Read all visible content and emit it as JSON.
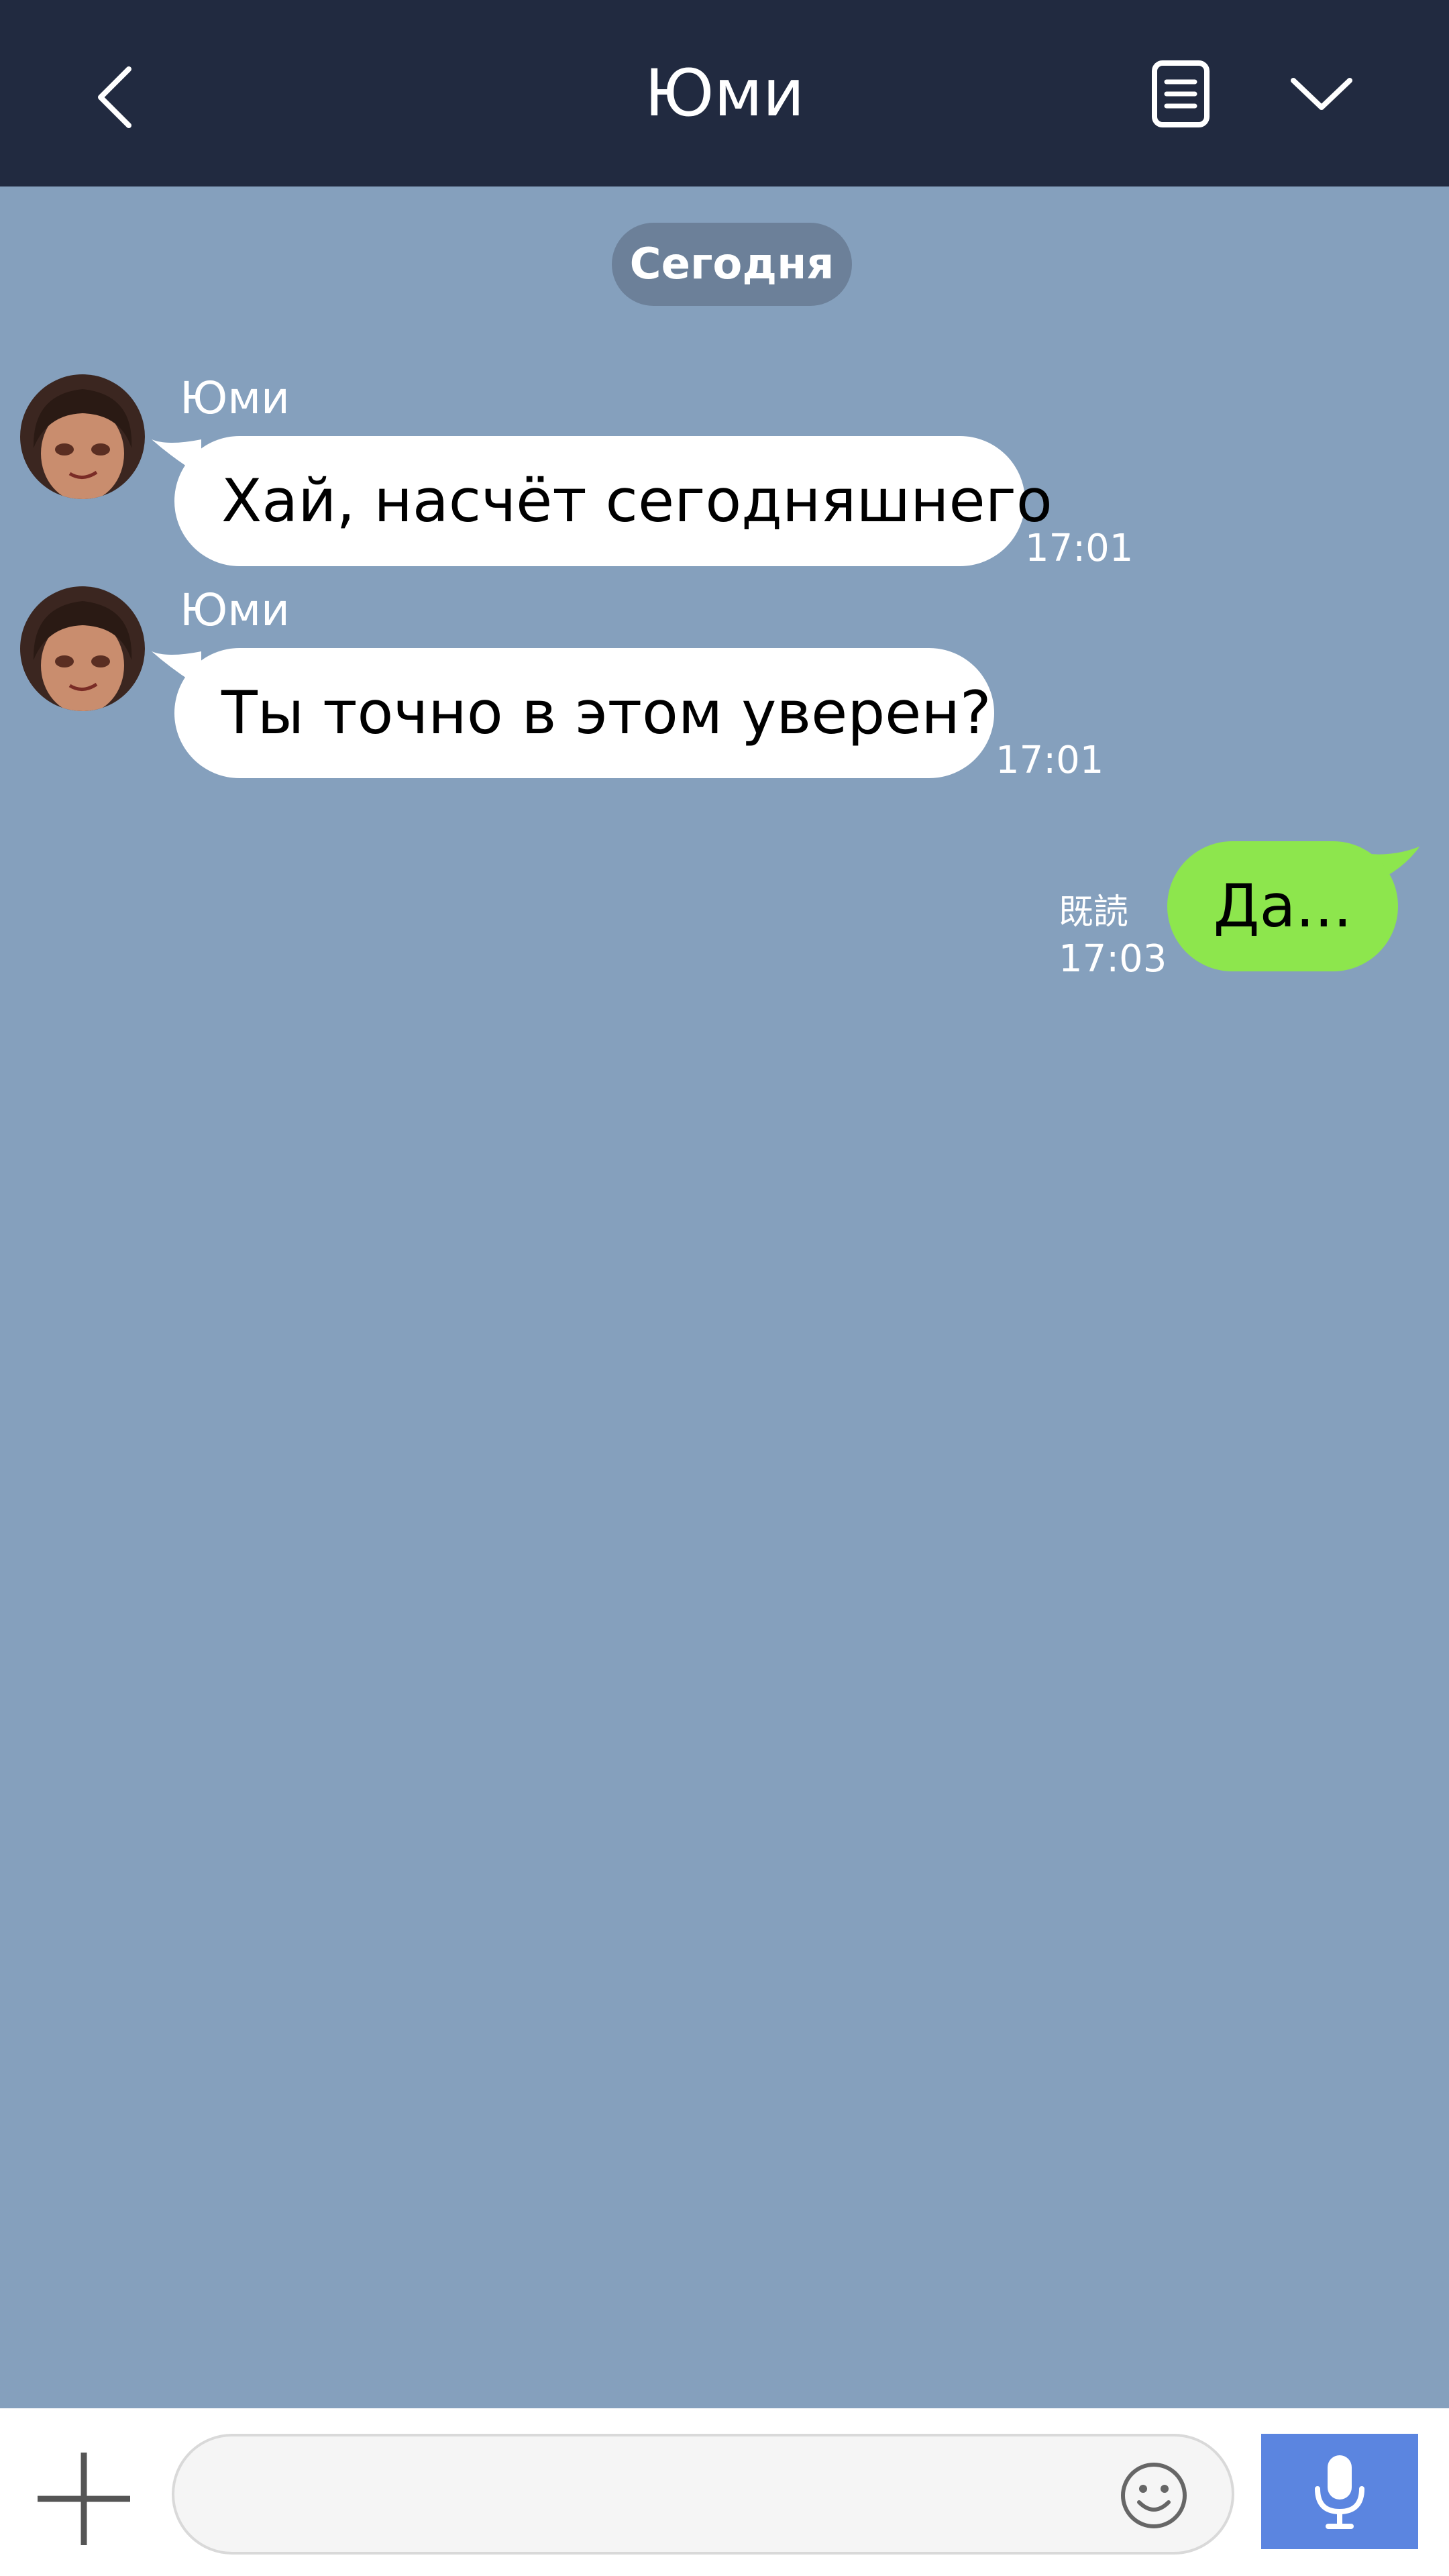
{
  "header": {
    "title": "Юми",
    "back_icon": "chevron-left-icon",
    "notes_icon": "notes-icon",
    "menu_icon": "chevron-down-icon",
    "background": "#212a40"
  },
  "chat": {
    "background": "#85a0bd",
    "date_label": "Сегодня",
    "messages": [
      {
        "direction": "incoming",
        "sender": "Юми",
        "text": "Хай, насчёт сегодняшнего",
        "time": "17:01"
      },
      {
        "direction": "incoming",
        "sender": "Юми",
        "text": "Ты точно в этом уверен?",
        "time": "17:01"
      },
      {
        "direction": "outgoing",
        "text": "Да...",
        "time": "17:03",
        "status": "既読"
      }
    ]
  },
  "composer": {
    "plus_icon": "plus-icon",
    "input_value": "",
    "emoji_icon": "smiley-icon",
    "mic_icon": "microphone-icon",
    "mic_color": "#5b85e0"
  },
  "colors": {
    "incoming_bubble": "#ffffff",
    "outgoing_bubble": "#8de64d",
    "date_pill": "#6c8099"
  }
}
